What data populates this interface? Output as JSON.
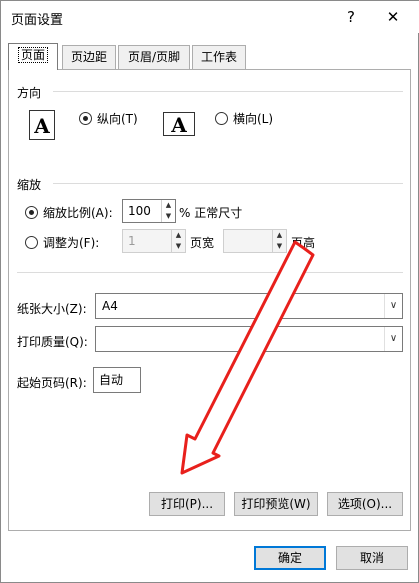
{
  "window": {
    "title": "页面设置",
    "help_label": "?",
    "close_label": "✕"
  },
  "tabs": [
    "页面",
    "页边距",
    "页眉/页脚",
    "工作表"
  ],
  "orientation": {
    "section_label": "方向",
    "icon_letter": "A",
    "portrait_label": "纵向(T)",
    "landscape_label": "横向(L)",
    "selected": "portrait"
  },
  "scaling": {
    "section_label": "缩放",
    "adjust_label": "缩放比例(A):",
    "adjust_value": "100",
    "adjust_suffix": "% 正常尺寸",
    "fit_label": "调整为(F):",
    "fit_wide_value": "1",
    "fit_wide_suffix": "页宽",
    "fit_tall_value": "",
    "fit_tall_suffix": "页高",
    "selected": "adjust"
  },
  "paper": {
    "size_label": "纸张大小(Z):",
    "size_value": "A4",
    "quality_label": "打印质量(Q):",
    "quality_value": "",
    "first_page_label": "起始页码(R):",
    "first_page_value": "自动"
  },
  "buttons": {
    "print": "打印(P)...",
    "print_preview": "打印预览(W)",
    "options": "选项(O)...",
    "ok": "确定",
    "cancel": "取消"
  },
  "icons": {
    "arrow_color": "#e8201c",
    "spin_up": "▲",
    "spin_down": "▼",
    "dropdown": "∨"
  }
}
